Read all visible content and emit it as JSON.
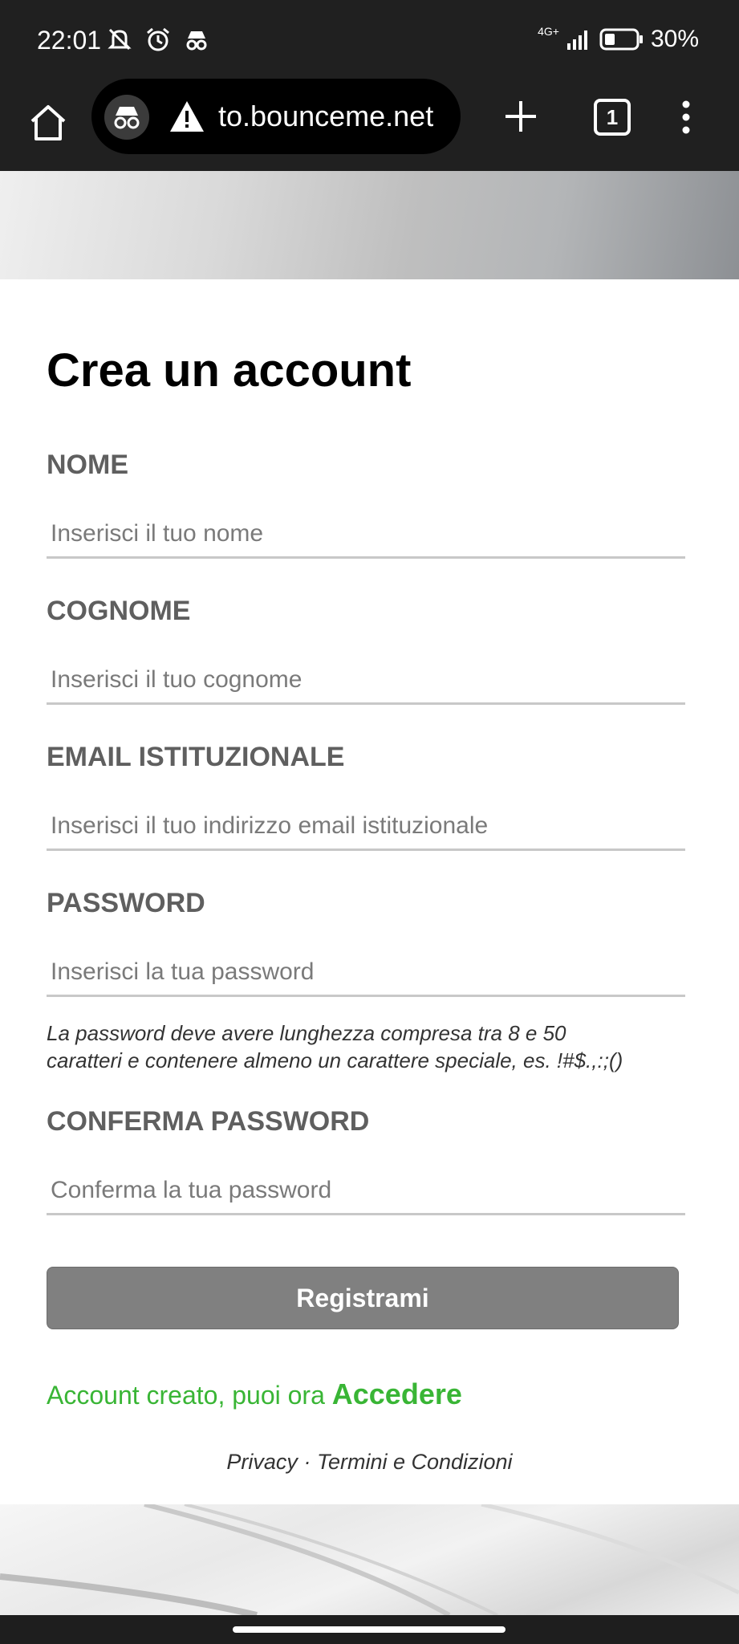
{
  "status_bar": {
    "time": "22:01",
    "network": "4G+",
    "battery": "30%"
  },
  "browser": {
    "url": "to.bounceme.net",
    "tab_count": "1",
    "icons": [
      "home-icon",
      "incognito-icon",
      "warning-icon",
      "plus-icon",
      "tabs-icon",
      "more-vert-icon"
    ]
  },
  "form": {
    "title": "Crea un account",
    "fields": {
      "nome": {
        "label": "NOME",
        "placeholder": "Inserisci il tuo nome",
        "value": ""
      },
      "cognome": {
        "label": "COGNOME",
        "placeholder": "Inserisci il tuo cognome",
        "value": ""
      },
      "email": {
        "label": "EMAIL ISTITUZIONALE",
        "placeholder": "Inserisci il tuo indirizzo email istituzionale",
        "value": ""
      },
      "password": {
        "label": "PASSWORD",
        "placeholder": "Inserisci la tua password",
        "value": ""
      },
      "confirm": {
        "label": "CONFERMA PASSWORD",
        "placeholder": "Conferma la tua password",
        "value": ""
      }
    },
    "password_hint_line1": "La password deve avere lunghezza compresa tra 8 e 50",
    "password_hint_line2": "caratteri e contenere almeno un carattere speciale, es. !#$.,:;()",
    "submit_label": "Registrami",
    "success_text": "Account creato, puoi ora ",
    "success_link": "Accedere"
  },
  "footer": {
    "privacy": "Privacy",
    "separator": " · ",
    "terms": "Termini e Condizioni"
  },
  "colors": {
    "success": "#39b535",
    "button": "#808080",
    "label": "#5f5f5f"
  }
}
